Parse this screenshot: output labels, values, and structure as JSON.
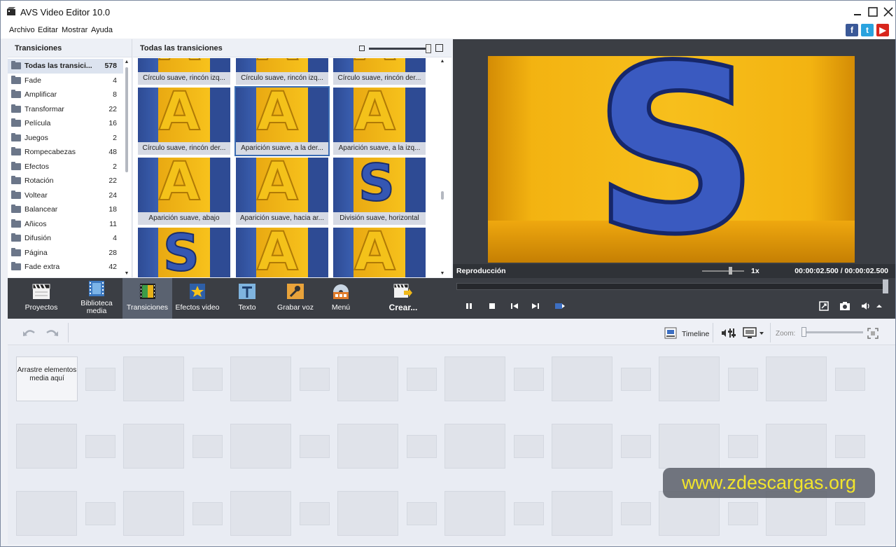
{
  "window": {
    "title": "AVS Video Editor 10.0"
  },
  "menu": [
    "Archivo",
    "Editar",
    "Mostrar",
    "Ayuda"
  ],
  "social": [
    {
      "name": "facebook",
      "glyph": "f",
      "color": "#3b5998"
    },
    {
      "name": "twitter",
      "glyph": "t",
      "color": "#2aa3df"
    },
    {
      "name": "youtube",
      "glyph": "▶",
      "color": "#d8261d"
    }
  ],
  "categories_panel": {
    "title": "Transiciones",
    "items": [
      {
        "label": "Todas las transici...",
        "count": "578",
        "selected": true
      },
      {
        "label": "Fade",
        "count": "4"
      },
      {
        "label": "Amplificar",
        "count": "8"
      },
      {
        "label": "Transformar",
        "count": "22"
      },
      {
        "label": "Película",
        "count": "16"
      },
      {
        "label": "Juegos",
        "count": "2"
      },
      {
        "label": "Rompecabezas",
        "count": "48"
      },
      {
        "label": "Efectos",
        "count": "2"
      },
      {
        "label": "Rotación",
        "count": "22"
      },
      {
        "label": "Voltear",
        "count": "24"
      },
      {
        "label": "Balancear",
        "count": "18"
      },
      {
        "label": "Añicos",
        "count": "11"
      },
      {
        "label": "Difusión",
        "count": "4"
      },
      {
        "label": "Página",
        "count": "28"
      },
      {
        "label": "Fade extra",
        "count": "42"
      }
    ]
  },
  "transitions_panel": {
    "title": "Todas las transiciones",
    "thumbs": [
      {
        "caption": "Círculo suave, rincón izq...",
        "letter": "A"
      },
      {
        "caption": "Círculo suave, rincón izq...",
        "letter": "A"
      },
      {
        "caption": "Círculo suave, rincón der...",
        "letter": "A"
      },
      {
        "caption": "Círculo suave, rincón der...",
        "letter": "A"
      },
      {
        "caption": "Aparición suave, a la der...",
        "letter": "A",
        "selected": true
      },
      {
        "caption": "Aparición suave, a la izq...",
        "letter": "A"
      },
      {
        "caption": "Aparición suave, abajo",
        "letter": "A"
      },
      {
        "caption": "Aparición suave, hacia ar...",
        "letter": "A"
      },
      {
        "caption": "División suave, horizontal",
        "letter": "S"
      },
      {
        "caption": "",
        "letter": "S"
      },
      {
        "caption": "",
        "letter": "A"
      },
      {
        "caption": "",
        "letter": "A"
      }
    ]
  },
  "preview": {
    "letter": "S",
    "label": "Reproducción",
    "speed": "1x",
    "time_current": "00:00:02.500",
    "time_separator": "/",
    "time_total": "00:00:02.500"
  },
  "toolbar": {
    "items": [
      {
        "label": "Proyectos",
        "icon": "clapperboard-icon"
      },
      {
        "label": "Biblioteca media",
        "icon": "film-library-icon"
      },
      {
        "label": "Transiciones",
        "icon": "transitions-icon",
        "active": true
      },
      {
        "label": "Efectos video",
        "icon": "star-effects-icon"
      },
      {
        "label": "Texto",
        "icon": "text-t-icon"
      },
      {
        "label": "Grabar voz",
        "icon": "microphone-icon"
      },
      {
        "label": "Menú",
        "icon": "disc-menu-icon"
      },
      {
        "label": "Crear...",
        "icon": "create-export-icon"
      }
    ]
  },
  "timeline": {
    "view_label": "Timeline",
    "zoom_label": "Zoom:",
    "drop_text": "Arrastre elementos media aquí"
  },
  "watermark": "www.zdescargas.org"
}
